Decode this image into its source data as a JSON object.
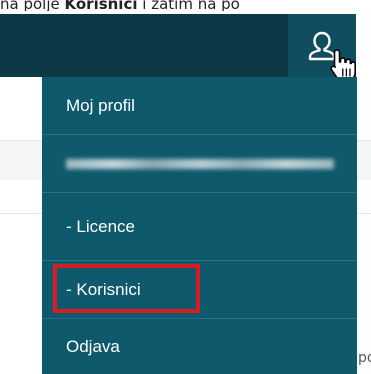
{
  "caption": {
    "prefix": "na polje ",
    "bold": "Korisnici",
    "suffix": " i zatim na po"
  },
  "icons": {
    "user": "user-icon",
    "cursor": "hand-pointer-icon"
  },
  "user_menu": {
    "items": [
      {
        "label": "Moj profil"
      },
      {
        "label": ""
      },
      {
        "label": "-  Licence"
      },
      {
        "label": "-  Korisnici"
      },
      {
        "label": "Odjava"
      }
    ]
  },
  "page_fragment": "po",
  "colors": {
    "header": "#0d3845",
    "header_active": "#104d5e",
    "menu_bg": "#0e5a6c",
    "menu_divider": "#2a7385",
    "highlight": "#d91c24"
  }
}
